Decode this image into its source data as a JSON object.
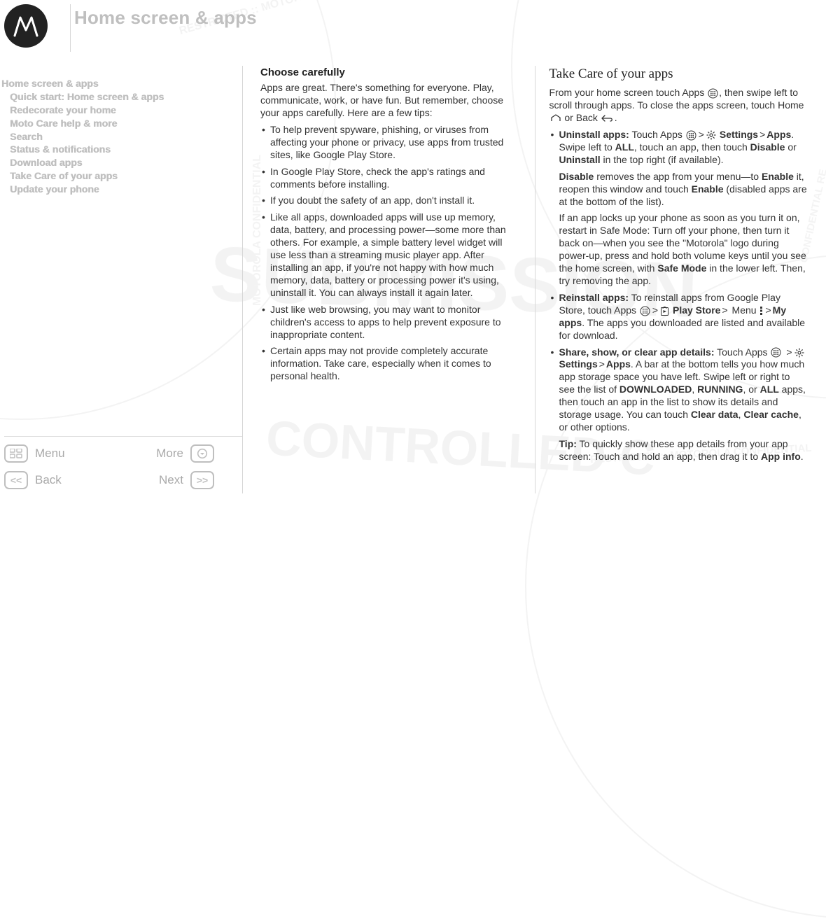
{
  "header": {
    "title": "Home screen & apps"
  },
  "sidebar": {
    "heading": "Home screen & apps",
    "items": [
      "Quick start: Home screen & apps",
      "Redecorate your home",
      "Moto Care help & more",
      "Search",
      "Status & notifications",
      "Download apps",
      "Take Care of your apps",
      "Update your phone"
    ]
  },
  "nav": {
    "menu": "Menu",
    "more": "More",
    "back": "Back",
    "next": "Next"
  },
  "col1": {
    "h": "Choose carefully",
    "intro": "Apps are great. There's something for everyone. Play, communicate, work, or have fun. But remember, choose your apps carefully. Here are a few tips:",
    "b1": "To help prevent spyware, phishing, or viruses from affecting your phone or privacy, use apps from trusted sites, like Google Play Store.",
    "b2": "In Google Play Store, check the app's ratings and comments before installing.",
    "b3": "If you doubt the safety of an app, don't install it.",
    "b4": "Like all apps, downloaded apps will use up memory, data, battery, and processing power—some more than others. For example, a simple battery level widget will use less than a streaming music player app. After installing an app, if you're not happy with how much memory, data, battery or processing power it's using, uninstall it. You can always install it again later.",
    "b5": "Just like web browsing, you may want to monitor children's access to apps to help prevent exposure to inappropriate content.",
    "b6": "Certain apps may not provide completely accurate information. Take care, especially when it comes to personal health."
  },
  "col2": {
    "h": "Take Care of your apps",
    "intro_a": "From your home screen touch Apps ",
    "intro_b": ", then swipe left to scroll through apps. To close the apps screen, touch Home ",
    "intro_c": " or Back ",
    "intro_d": ".",
    "u1_lead": "Uninstall apps:",
    "u1_a": " Touch Apps ",
    "u1_b": " Settings",
    "u1_c": "Apps",
    "u1_d": ". Swipe left to ",
    "u1_all": "ALL",
    "u1_e": ", touch an app, then touch ",
    "u1_disable": "Disable",
    "u1_f": " or ",
    "u1_uninstall": "Uninstall",
    "u1_g": " in the top right (if available).",
    "u1_p2_a": "Disable",
    "u1_p2_b": " removes the app from your menu—to ",
    "u1_p2_c": "Enable",
    "u1_p2_d": " it, reopen this window and touch ",
    "u1_p2_e": "Enable",
    "u1_p2_f": " (disabled apps are at the bottom of the list).",
    "u1_p3_a": "If an app locks up your phone as soon as you turn it on, restart in Safe Mode: Turn off your phone, then turn it back on—when you see the \"Motorola\" logo during power-up, press and hold both volume keys until you see the home screen, with ",
    "u1_p3_b": "Safe Mode",
    "u1_p3_c": " in the lower left. Then, try removing the app.",
    "u2_lead": "Reinstall apps:",
    "u2_a": " To reinstall apps from Google Play Store, touch Apps ",
    "u2_b": " Play Store",
    "u2_c": " Menu ",
    "u2_d": "My apps",
    "u2_e": ". The apps you downloaded are listed and available for download.",
    "u3_lead": "Share, show, or clear app details:",
    "u3_a": " Touch Apps ",
    "u3_b": " Settings",
    "u3_c": "Apps",
    "u3_d": ". A bar at the bottom tells you how much app storage space you have left. Swipe left or right to see the list of ",
    "u3_dl": "DOWNLOADED",
    "u3_e": ", ",
    "u3_run": "RUNNING",
    "u3_f": ", or ",
    "u3_all": "ALL",
    "u3_g": " apps, then touch an app in the list to show its details and storage usage. You can touch ",
    "u3_cd": "Clear data",
    "u3_h": ", ",
    "u3_cc": "Clear cache",
    "u3_i": ", or other options.",
    "tip_a": "Tip:",
    "tip_b": " To quickly show these app details from your app screen: Touch and hold an app, then drag it to ",
    "tip_c": "App info",
    "tip_d": "."
  },
  "arrow": ">"
}
